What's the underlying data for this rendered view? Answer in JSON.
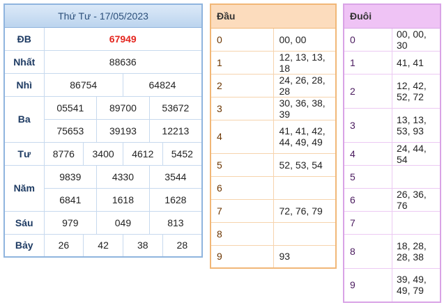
{
  "results": {
    "title": "Thứ Tư - 17/05/2023",
    "db": {
      "label": "ĐB",
      "values": [
        "67949"
      ]
    },
    "nhat": {
      "label": "Nhất",
      "values": [
        "88636"
      ]
    },
    "nhi": {
      "label": "Nhì",
      "values": [
        "86754",
        "64824"
      ]
    },
    "ba": {
      "label": "Ba",
      "values": [
        "05541",
        "89700",
        "53672",
        "75653",
        "39193",
        "12213"
      ]
    },
    "tu": {
      "label": "Tư",
      "values": [
        "8776",
        "3400",
        "4612",
        "5452"
      ]
    },
    "nam": {
      "label": "Năm",
      "values": [
        "9839",
        "4330",
        "3544",
        "6841",
        "1618",
        "1628"
      ]
    },
    "sau": {
      "label": "Sáu",
      "values": [
        "979",
        "049",
        "813"
      ]
    },
    "bay": {
      "label": "Bảy",
      "values": [
        "26",
        "42",
        "38",
        "28"
      ]
    }
  },
  "dau": {
    "header": "Đầu",
    "rows": [
      {
        "key": "0",
        "value": "00, 00"
      },
      {
        "key": "1",
        "value": "12, 13, 13, 18"
      },
      {
        "key": "2",
        "value": "24, 26, 28, 28"
      },
      {
        "key": "3",
        "value": "30, 36, 38, 39"
      },
      {
        "key": "4",
        "value": "41, 41, 42, 44, 49, 49"
      },
      {
        "key": "5",
        "value": "52, 53, 54"
      },
      {
        "key": "6",
        "value": ""
      },
      {
        "key": "7",
        "value": "72, 76, 79"
      },
      {
        "key": "8",
        "value": ""
      },
      {
        "key": "9",
        "value": "93"
      }
    ]
  },
  "duoi": {
    "header": "Đuôi",
    "rows": [
      {
        "key": "0",
        "value": "00, 00, 30"
      },
      {
        "key": "1",
        "value": "41, 41"
      },
      {
        "key": "2",
        "value": "12, 42, 52, 72"
      },
      {
        "key": "3",
        "value": "13, 13, 53, 93"
      },
      {
        "key": "4",
        "value": "24, 44, 54"
      },
      {
        "key": "5",
        "value": ""
      },
      {
        "key": "6",
        "value": "26, 36, 76"
      },
      {
        "key": "7",
        "value": ""
      },
      {
        "key": "8",
        "value": "18, 28, 28, 38"
      },
      {
        "key": "9",
        "value": "39, 49, 49, 79"
      }
    ]
  }
}
